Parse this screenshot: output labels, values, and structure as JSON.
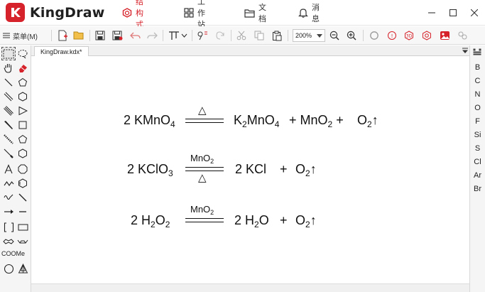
{
  "app": {
    "name": "KingDraw"
  },
  "nav": {
    "items": [
      {
        "label": "结构式",
        "active": true,
        "icon": "hexagon-icon"
      },
      {
        "label": "工作站",
        "active": false,
        "icon": "grid-icon"
      },
      {
        "label": "文档",
        "active": false,
        "icon": "folder-icon"
      },
      {
        "label": "消息",
        "active": false,
        "icon": "bell-icon"
      }
    ]
  },
  "toolbar": {
    "menu_label": "菜单(M)",
    "zoom": "200%"
  },
  "tab": {
    "filename": "KingDraw.kdx*"
  },
  "canvas": {
    "eq1": {
      "lhs": {
        "pre": "2 KMnO",
        "sub": "4"
      },
      "condition_top": "△",
      "p1": {
        "pre": "K",
        "sub1": "2",
        "mid": "MnO",
        "sub2": "4"
      },
      "p2": {
        "pre": "+ MnO",
        "sub": "2",
        "post": " +"
      },
      "p3": {
        "pre": "O",
        "sub": "2",
        "post": "↑"
      }
    },
    "eq2": {
      "lhs": {
        "pre": "2 KClO",
        "sub": "3"
      },
      "condition_top": {
        "pre": "MnO",
        "sub": "2"
      },
      "condition_bottom": "△",
      "p1": "2 KCl",
      "plus": "+",
      "p2": {
        "pre": "O",
        "sub": "2",
        "post": "↑"
      }
    },
    "eq3": {
      "lhs": {
        "pre": "2 H",
        "sub1": "2",
        "mid": "O",
        "sub2": "2"
      },
      "condition_top": {
        "pre": "MnO",
        "sub": "2"
      },
      "p1": {
        "pre": "2 H",
        "sub": "2",
        "post": "O"
      },
      "plus": "+",
      "p2": {
        "pre": "O",
        "sub": "2",
        "post": "↑"
      }
    }
  },
  "left_panel": {
    "template_label": "COOMe"
  },
  "elements": [
    "B",
    "C",
    "N",
    "O",
    "F",
    "Si",
    "S",
    "Cl",
    "Ar",
    "Br"
  ],
  "colors": {
    "brand": "#d6222a",
    "accent_red": "#d6222a"
  }
}
